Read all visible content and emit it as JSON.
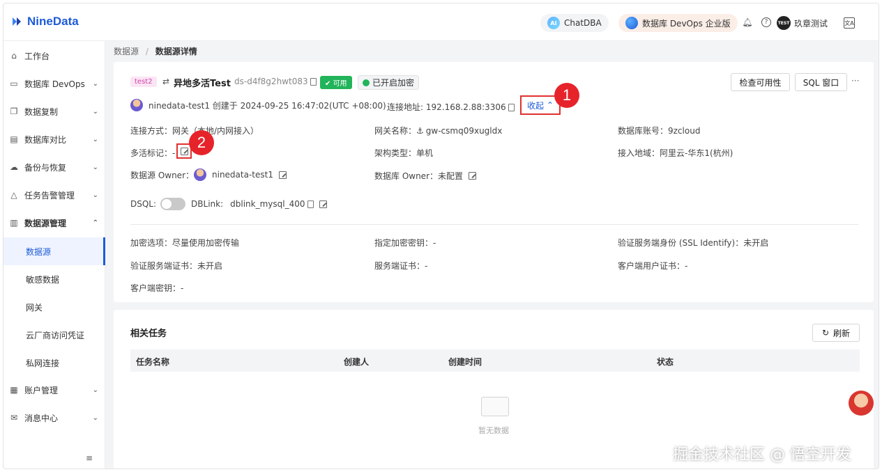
{
  "brand": {
    "name": "NineData"
  },
  "topbar": {
    "chatdba_label": "ChatDBA",
    "chatdba_badge": "AI",
    "devops_label": "数据库 DevOps 企业版",
    "user_badge": "TEST",
    "user_name": "玖章测试",
    "lang_label": "文A"
  },
  "sidebar": {
    "items": [
      {
        "label": "工作台",
        "icon": "home-icon"
      },
      {
        "label": "数据库 DevOps",
        "icon": "monitor-icon"
      },
      {
        "label": "数据复制",
        "icon": "copy-icon"
      },
      {
        "label": "数据库对比",
        "icon": "compare-icon"
      },
      {
        "label": "备份与恢复",
        "icon": "cloud-icon"
      },
      {
        "label": "任务告警管理",
        "icon": "alarm-icon"
      },
      {
        "label": "数据源管理",
        "icon": "database-icon"
      },
      {
        "label": "账户管理",
        "icon": "account-icon"
      },
      {
        "label": "消息中心",
        "icon": "mail-icon"
      }
    ],
    "subitems": [
      "数据源",
      "敏感数据",
      "网关",
      "云厂商访问凭证",
      "私网连接"
    ]
  },
  "breadcrumb": {
    "parent": "数据源",
    "separator": "/",
    "current": "数据源详情"
  },
  "detail": {
    "tag": "test2",
    "name": "异地多活Test",
    "id": "ds-d4f8g2hwt083",
    "status": "可用",
    "encryption": "已开启加密",
    "check_button": "检查可用性",
    "sql_button": "SQL 窗口",
    "more": "···",
    "creator_line": "ninedata-test1 创建于 2024-09-25 16:47:02(UTC +08:00)",
    "conn_addr": "连接地址: 192.168.2.88:3306",
    "collapse": "收起",
    "marker1": "1",
    "marker2": "2",
    "fields": {
      "conn_mode": "连接方式：网关（本地/内网接入）",
      "gateway_name": "网关名称：",
      "gateway_value": "gw-csmq09xugldx",
      "db_account": "数据库账号：9zcloud",
      "active_mark": "多活标记：-",
      "arch_type": "架构类型：单机",
      "region": "接入地域：阿里云-华东1(杭州)",
      "ds_owner_label": "数据源 Owner：",
      "ds_owner_value": "ninedata-test1",
      "db_owner": "数据库 Owner：未配置",
      "dsql_label": "DSQL:",
      "dblink_label": "DBLink:",
      "dblink_value": "dblink_mysql_400",
      "encrypt_option": "加密选项：尽量使用加密传输",
      "encrypt_key": "指定加密密钥：-",
      "ssl_identify": "验证服务端身份 (SSL Identify)：未开启",
      "server_cert_verify": "验证服务端证书：未开启",
      "server_cert": "服务端证书：-",
      "client_cert": "客户端用户证书：-",
      "client_key": "客户端密钥：-"
    }
  },
  "tasks": {
    "title": "相关任务",
    "refresh": "刷新",
    "columns": [
      "任务名称",
      "创建人",
      "创建时间",
      "状态"
    ],
    "empty": "暂无数据"
  },
  "watermark": "掘金技术社区 @ 悟空开发"
}
